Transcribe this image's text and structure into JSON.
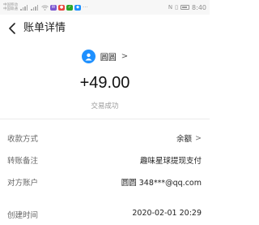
{
  "statusbar": {
    "carrier_top": "中国移动",
    "carrier_bottom": "中国联通",
    "right_text": "8:40"
  },
  "nav": {
    "back_icon": "chevron-left-icon",
    "title": "账单详情"
  },
  "payee": {
    "name": "圆圆",
    "chevron": ">"
  },
  "amount": "+49.00",
  "status": "交易成功",
  "details": [
    {
      "label": "收款方式",
      "value": "余额",
      "chevron": ">"
    },
    {
      "label": "转账备注",
      "value": "趣味星球提现支付"
    },
    {
      "label": "对方账户",
      "value": "圆圆 348***@qq.com"
    },
    {
      "label": "创建时间",
      "value": "2020-02-01 20:29"
    }
  ],
  "colors": {
    "accent": "#1e90ff",
    "text_primary": "#222222",
    "text_secondary": "#9a9a9a"
  }
}
